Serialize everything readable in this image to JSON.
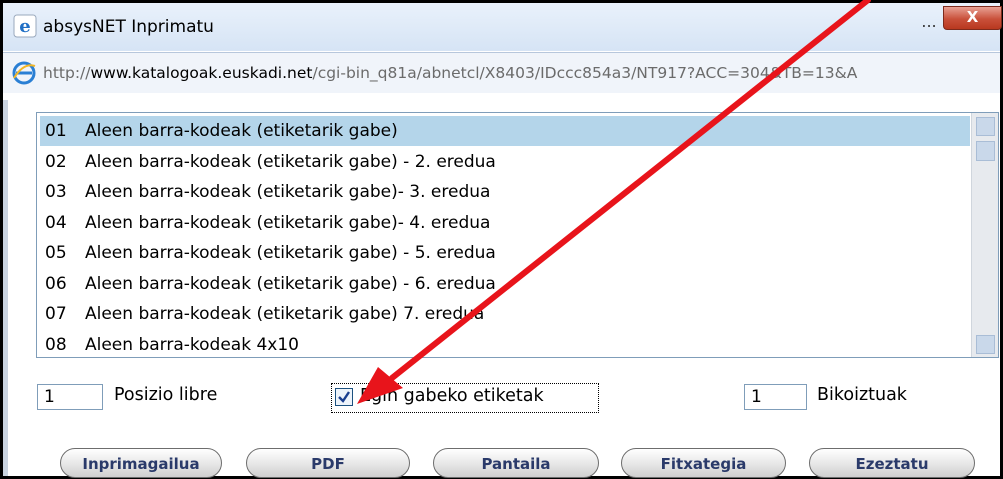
{
  "window": {
    "title": "absysNET Inprimatu",
    "minimize_label": "...",
    "close_label": "X"
  },
  "address": {
    "url_prefix": "http://",
    "url_host": "www.katalogoak.euskadi.net",
    "url_path": "/cgi-bin_q81a/abnetcl/X8403/IDccc854a3/NT917?ACC=304&TB=13&A"
  },
  "list": {
    "items": [
      {
        "num": "01",
        "label": "Aleen barra-kodeak (etiketarik gabe)"
      },
      {
        "num": "02",
        "label": "Aleen barra-kodeak (etiketarik gabe) - 2. eredua"
      },
      {
        "num": "03",
        "label": "Aleen barra-kodeak (etiketarik gabe)- 3. eredua"
      },
      {
        "num": "04",
        "label": "Aleen barra-kodeak (etiketarik gabe)- 4. eredua"
      },
      {
        "num": "05",
        "label": "Aleen barra-kodeak (etiketarik gabe) - 5. eredua"
      },
      {
        "num": "06",
        "label": "Aleen barra-kodeak (etiketarik gabe) - 6. eredua"
      },
      {
        "num": "07",
        "label": "Aleen barra-kodeak (etiketarik gabe) 7. eredua"
      },
      {
        "num": "08",
        "label": "Aleen barra-kodeak 4x10"
      }
    ],
    "selected_index": 0
  },
  "options": {
    "position_value": "1",
    "position_label": "Posizio libre",
    "unprinted_label": "Egin gabeko etiketak",
    "unprinted_checked": true,
    "duplicates_value": "1",
    "duplicates_label": "Bikoiztuak"
  },
  "buttons": {
    "printer": "Inprimagailua",
    "pdf": "PDF",
    "screen": "Pantaila",
    "file": "Fitxategia",
    "cancel": "Ezeztatu"
  },
  "colors": {
    "selection": "#b4d5ea",
    "annotation_arrow": "#e8141b"
  }
}
